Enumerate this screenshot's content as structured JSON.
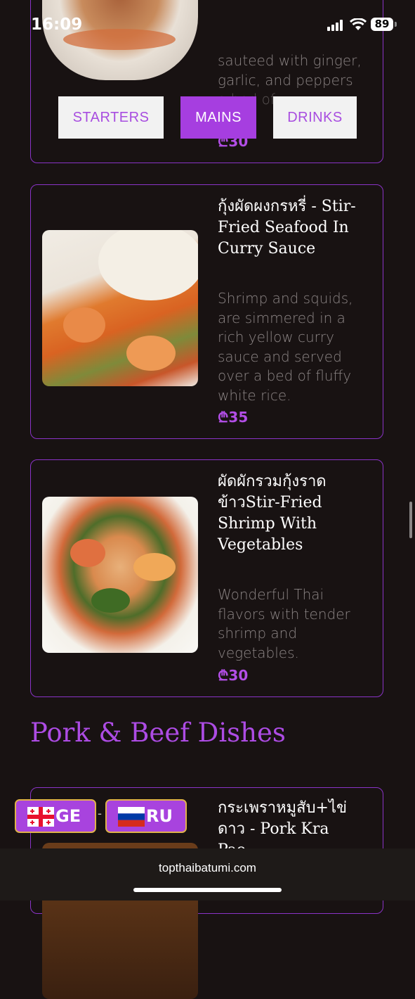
{
  "status": {
    "time": "16:09",
    "battery": "89"
  },
  "tabs": [
    {
      "label": "STARTERS",
      "active": false
    },
    {
      "label": "MAINS",
      "active": true
    },
    {
      "label": "DRINKS",
      "active": false
    }
  ],
  "items": [
    {
      "title": "",
      "description": "sauteed with ginger, garlic, and peppers",
      "desc_partial": "a bed of",
      "price": "₾30"
    },
    {
      "title": "กุ้งผัดผงกรหรี่ - Stir-Fried Seafood In Curry Sauce",
      "description": "Shrimp and squids, are simmered in a rich yellow curry sauce and served over a bed of fluffy white rice.",
      "price": "₾35"
    },
    {
      "title": "ผัดผักรวมกุ้งราดข้าวStir-Fried Shrimp With Vegetables",
      "description": "Wonderful Thai flavors with tender shrimp and vegetables.",
      "price": "₾30"
    },
    {
      "title": "กระเพราหมูสับ+ไข่ดาว - Pork Kra Pao"
    }
  ],
  "section": {
    "title": "Pork & Beef Dishes"
  },
  "languages": [
    {
      "code": "GE",
      "flag_icon": "georgia-flag-icon"
    },
    {
      "code": "RU",
      "flag_icon": "russia-flag-icon"
    }
  ],
  "language_separator": "-",
  "browser": {
    "url": "topthaibatumi.com"
  }
}
